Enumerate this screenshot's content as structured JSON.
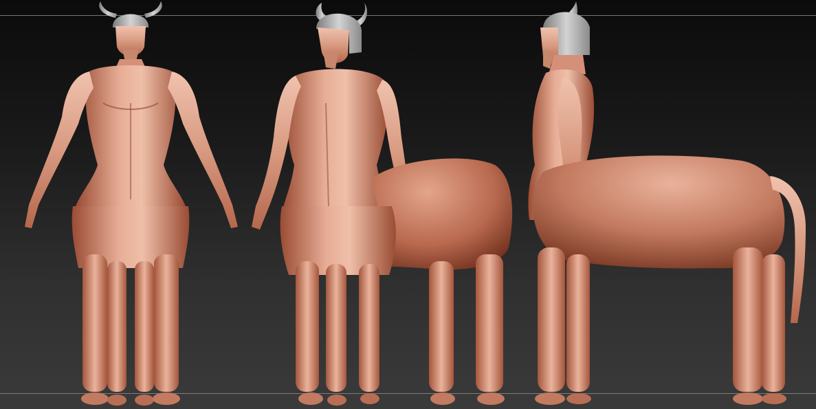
{
  "viewport": {
    "background_top": "#0b0b0b",
    "background_bottom": "#3a3a3a",
    "guide_color": "#8a8a8a"
  },
  "material": {
    "highlight": "#f2c3b0",
    "mid": "#c98a72",
    "shadow": "#7a3a26",
    "deep": "#4a1c10",
    "helmet": "#b7b7b7"
  },
  "views": [
    {
      "name": "front-view"
    },
    {
      "name": "three-quarter-view"
    },
    {
      "name": "side-view"
    }
  ]
}
